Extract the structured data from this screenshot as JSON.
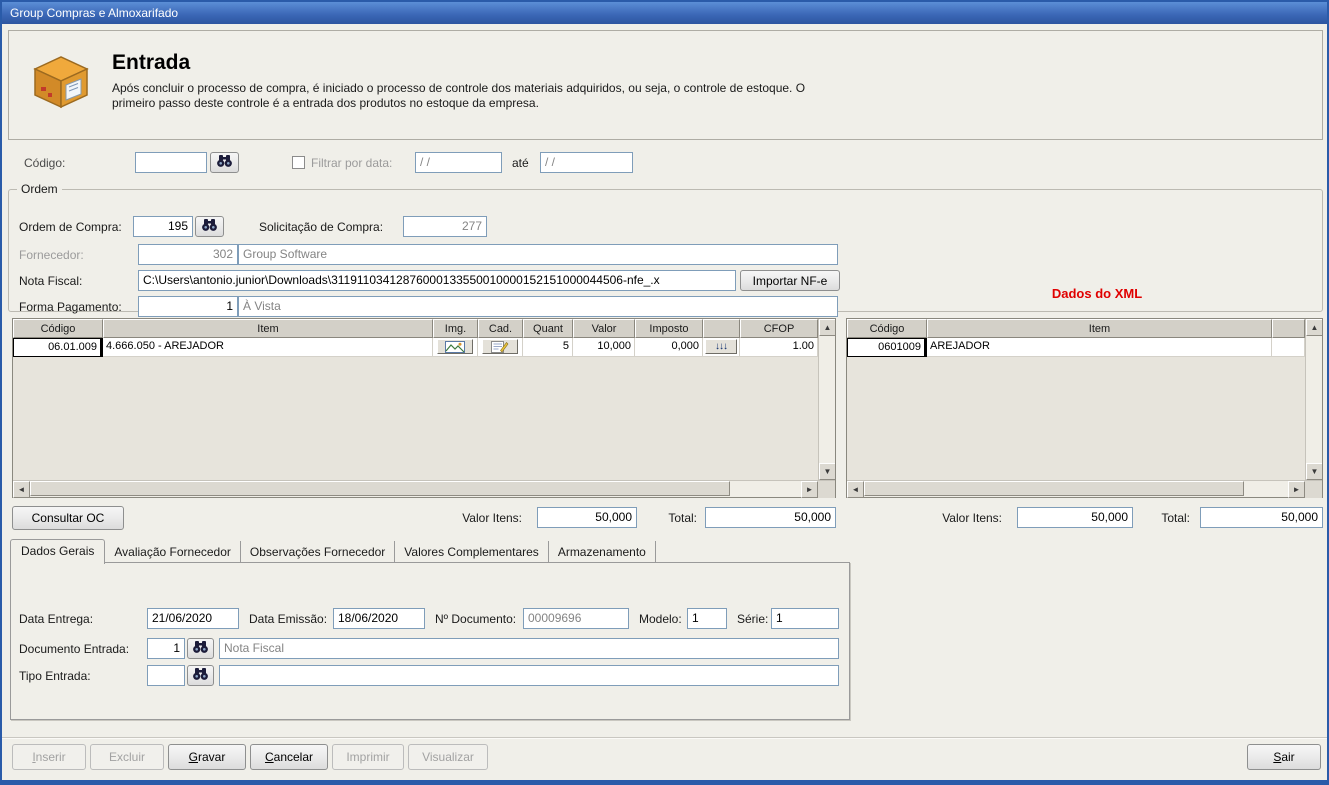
{
  "window": {
    "title": "Group Compras e Almoxarifado"
  },
  "header": {
    "title": "Entrada",
    "description": "Após concluir o processo de compra, é iniciado o processo de controle dos materiais adquiridos, ou seja, o controle de estoque. O primeiro passo deste controle é a entrada dos produtos no estoque da empresa."
  },
  "filter": {
    "codigo_label": "Código:",
    "codigo_value": "",
    "filtrar_por_data_label": "Filtrar por data:",
    "date_from": "/ /",
    "ate_label": "até",
    "date_to": "/ /"
  },
  "ordem": {
    "group_title": "Ordem",
    "ordem_de_compra_label": "Ordem de Compra:",
    "ordem_de_compra_value": "195",
    "solicitacao_de_compra_label": "Solicitação de Compra:",
    "solicitacao_de_compra_value": "277",
    "fornecedor_label": "Fornecedor:",
    "fornecedor_codigo": "302",
    "fornecedor_nome": "Group Software",
    "nota_fiscal_label": "Nota Fiscal:",
    "nota_fiscal_value": "C:\\Users\\antonio.junior\\Downloads\\31191103412876000133550010000152151000044506-nfe_.x",
    "importar_nfe_label": "Importar NF-e",
    "forma_pagamento_label": "Forma Pagamento:",
    "forma_pagamento_codigo": "1",
    "forma_pagamento_nome": "À Vista"
  },
  "xml_panel_title": "Dados do XML",
  "items_grid": {
    "columns": [
      "Código",
      "Item",
      "Img.",
      "Cad.",
      "Quant",
      "Valor",
      "Imposto",
      "",
      "CFOP"
    ],
    "rows": [
      {
        "codigo": "06.01.009",
        "item": "4.666.050 - AREJADOR",
        "quant": "5",
        "valor": "10,000",
        "imposto": "0,000",
        "arrows": "↓↓↓",
        "cfop": "1.00"
      }
    ]
  },
  "xml_grid": {
    "columns": [
      "Código",
      "Item",
      ""
    ],
    "rows": [
      {
        "codigo": "0601009",
        "item": "AREJADOR"
      }
    ]
  },
  "totals": {
    "consultar_oc_label": "Consultar OC",
    "valor_itens_label": "Valor Itens:",
    "total_label": "Total:",
    "left": {
      "valor_itens": "50,000",
      "total": "50,000"
    },
    "right": {
      "valor_itens": "50,000",
      "total": "50,000"
    }
  },
  "tabs": [
    {
      "label": "Dados Gerais",
      "active": true
    },
    {
      "label": "Avaliação Fornecedor",
      "active": false
    },
    {
      "label": "Observações Fornecedor",
      "active": false
    },
    {
      "label": "Valores Complementares",
      "active": false
    },
    {
      "label": "Armazenamento",
      "active": false
    }
  ],
  "dados_gerais": {
    "data_entrega_label": "Data Entrega:",
    "data_entrega_value": "21/06/2020",
    "data_emissao_label": "Data Emissão:",
    "data_emissao_value": "18/06/2020",
    "num_documento_label": "Nº Documento:",
    "num_documento_value": "00009696",
    "modelo_label": "Modelo:",
    "modelo_value": "1",
    "serie_label": "Série:",
    "serie_value": "1",
    "documento_entrada_label": "Documento Entrada:",
    "documento_entrada_codigo": "1",
    "documento_entrada_nome": "Nota Fiscal",
    "tipo_entrada_label": "Tipo Entrada:",
    "tipo_entrada_codigo": "",
    "tipo_entrada_nome": ""
  },
  "footer": {
    "buttons": [
      {
        "label": "Inserir",
        "enabled": false
      },
      {
        "label": "Excluir",
        "enabled": false
      },
      {
        "label": "Gravar",
        "enabled": true
      },
      {
        "label": "Cancelar",
        "enabled": true
      },
      {
        "label": "Imprimir",
        "enabled": false
      },
      {
        "label": "Visualizar",
        "enabled": false
      }
    ],
    "sair_label": "Sair"
  }
}
